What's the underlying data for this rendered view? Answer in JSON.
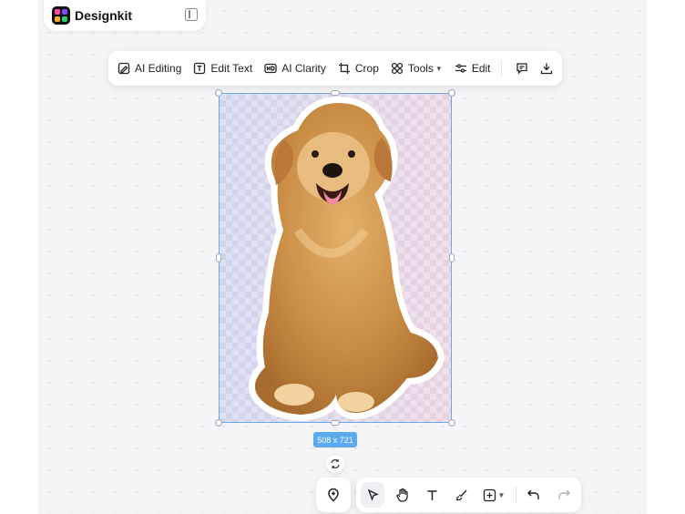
{
  "brand": {
    "name": "Designkit"
  },
  "toolbar": {
    "ai_editing": "AI Editing",
    "edit_text": "Edit Text",
    "ai_clarity": "AI Clarity",
    "crop": "Crop",
    "tools": "Tools",
    "edit": "Edit"
  },
  "selection": {
    "size_label": "508 x 721"
  },
  "icons": {
    "collapse": "sidebar-collapse-icon",
    "comment": "comment-icon",
    "download": "download-icon",
    "rotate": "rotate-icon",
    "add_point": "add-point-icon",
    "select": "cursor-arrow-icon",
    "hand": "hand-icon",
    "text": "text-tool-icon",
    "brush": "brush-icon",
    "add": "add-box-icon",
    "undo": "undo-icon",
    "redo": "redo-icon"
  },
  "colors": {
    "accent": "#5aaaf2",
    "canvas": "#f4f5f7",
    "selection_border": "#69a8ea"
  }
}
